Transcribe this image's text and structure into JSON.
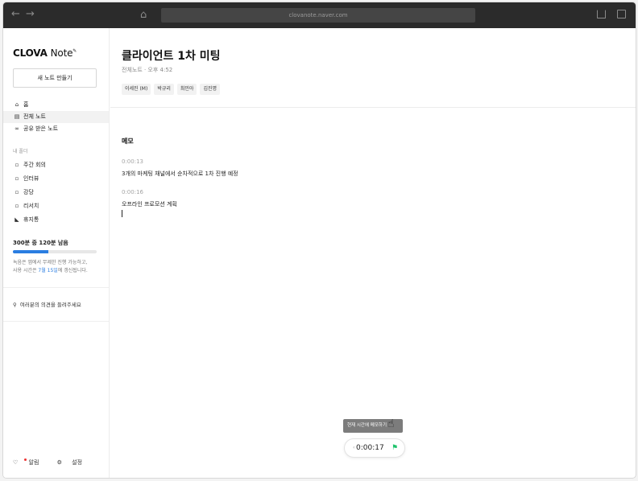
{
  "browser": {
    "url": "clovanote.naver.com",
    "back_icon": "arrow-left-icon",
    "forward_icon": "arrow-right-icon",
    "home_icon": "home-icon"
  },
  "sidebar": {
    "logo_brand": "CLOVA",
    "logo_note": "Note",
    "new_note_label": "새 노트 만들기",
    "nav_items": [
      {
        "label": "홈",
        "icon": "home-icon",
        "active": false
      },
      {
        "label": "전체 노트",
        "icon": "document-icon",
        "active": true
      },
      {
        "label": "공유 받은 노트",
        "icon": "share-icon",
        "active": false
      }
    ],
    "folder_header": "내 폴더",
    "folders": [
      {
        "label": "주간 회의",
        "icon": "folder-icon"
      },
      {
        "label": "인터뷰",
        "icon": "folder-icon"
      },
      {
        "label": "강당",
        "icon": "folder-icon"
      },
      {
        "label": "리서치",
        "icon": "folder-icon"
      },
      {
        "label": "휴지통",
        "icon": "trash-icon"
      }
    ],
    "usage": {
      "title": "300분 중 120분 남음",
      "fraction_used": 0.42,
      "desc_prefix": "녹음은 앱에서 무제한 진행 가능하고,",
      "desc_line2_prefix": "사용 시간은 ",
      "desc_highlight": "7월 15일",
      "desc_suffix": "에 갱신됩니다."
    },
    "feedback_label": "여러분의 의견을 들려주세요",
    "alerts_label": "알림",
    "settings_label": "설정"
  },
  "main": {
    "title": "클라이언트 1차 미팅",
    "meta": "전체노트 · 오후 4:52",
    "participants": [
      "이세진 (M)",
      "박규리",
      "최민아",
      "김진명"
    ],
    "memo_label": "메모",
    "entries": [
      {
        "time": "0:00:13",
        "text": "3개의 마케팅 채널에서 순차적으로 1차 진행 예정"
      },
      {
        "time": "0:00:16",
        "text": "오프라인 프로모션 계획"
      }
    ],
    "tooltip": "현재 시간에 메모하기",
    "player_time": "0:00:17"
  }
}
